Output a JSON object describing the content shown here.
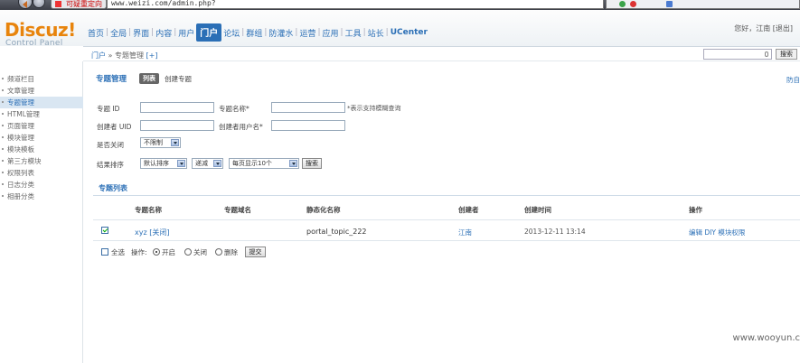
{
  "browser": {
    "tab_title": "可疑重定向",
    "url": "www.weizi.com/admin.php?"
  },
  "header": {
    "logo": "Discuz!",
    "logo_sub": "Control Panel",
    "nav": [
      "首页",
      "全局",
      "界面",
      "内容",
      "用户",
      "门户",
      "论坛",
      "群组",
      "防灌水",
      "运营",
      "应用",
      "工具",
      "站长",
      "UCenter"
    ],
    "active_nav": "门户",
    "greeting": "您好，江南",
    "logout": "[退出]"
  },
  "crumb": {
    "root": "门户",
    "sep": "»",
    "current": "专题管理",
    "add": "[+]"
  },
  "search": {
    "button": "搜索"
  },
  "sidebar": {
    "items": [
      "频道栏目",
      "文章管理",
      "专题管理",
      "HTML管理",
      "页面管理",
      "模块管理",
      "模块模板",
      "第三方模块",
      "权限列表",
      "日志分类",
      "相册分类"
    ],
    "active_index": 2
  },
  "main": {
    "title": "专题管理",
    "tab_list": "列表",
    "tab_create": "创建专题",
    "help": "防自"
  },
  "filters": {
    "topic_id_label": "专题 ID",
    "topic_name_label": "专题名称*",
    "fuzzy_note": "*表示支持模糊查询",
    "creator_uid_label": "创建者 UID",
    "creator_name_label": "创建者用户名*",
    "closed_label": "是否关闭",
    "closed_value": "不限制",
    "sort_label": "结果排序",
    "sort_value": "默认排序",
    "order_value": "递减",
    "perpage_value": "每页显示10个",
    "search_button": "搜索"
  },
  "list": {
    "title": "专题列表",
    "columns": [
      "专题名称",
      "专题域名",
      "静态化名称",
      "创建者",
      "创建时间",
      "操作"
    ],
    "rows": [
      {
        "checked": true,
        "name": "xyz [关闭]",
        "domain": "",
        "static_name": "portal_topic_222",
        "creator": "江南",
        "created": "2013-12-11 13:14",
        "actions": "编辑 DIY 模块权限"
      }
    ]
  },
  "batch": {
    "select_all": "全选",
    "op_label": "操作:",
    "options": [
      "开启",
      "关闭",
      "删除"
    ],
    "selected_option": "开启",
    "submit": "提交"
  },
  "watermark": "www.wooyun.c"
}
